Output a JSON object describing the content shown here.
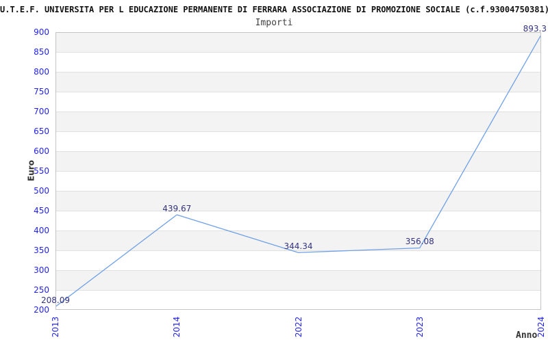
{
  "chart_data": {
    "type": "line",
    "title": "U.T.E.F. UNIVERSITA PER L EDUCAZIONE PERMANENTE DI FERRARA ASSOCIAZIONE DI PROMOZIONE SOCIALE (c.f.93004750381)",
    "subtitle": "Importi",
    "xlabel": "Anno",
    "ylabel": "Euro",
    "categories": [
      "2013",
      "2014",
      "2022",
      "2023",
      "2024"
    ],
    "series": [
      {
        "name": "Importi",
        "values": [
          208.09,
          439.67,
          344.34,
          356.08,
          893.3
        ],
        "point_labels": [
          "208.09",
          "439.67",
          "344.34",
          "356.08",
          "893.3"
        ]
      }
    ],
    "ylim": [
      200,
      900
    ],
    "ytick_step": 50,
    "ytick_labels": [
      "200",
      "250",
      "300",
      "350",
      "400",
      "450",
      "500",
      "550",
      "600",
      "650",
      "700",
      "750",
      "800",
      "850",
      "900"
    ],
    "grid": "horizontal-bands-alternating",
    "legend": "none"
  },
  "colors": {
    "line": "#6fa0e6",
    "axis_tick_text": "#2222ee",
    "point_label_text": "#333380",
    "band_fill": "#f3f3f3",
    "gridline": "#e0e0e0",
    "plot_border": "#c4c4c4",
    "title_text": "#111111",
    "subtitle_text": "#404040",
    "axis_title_text": "#333333"
  }
}
